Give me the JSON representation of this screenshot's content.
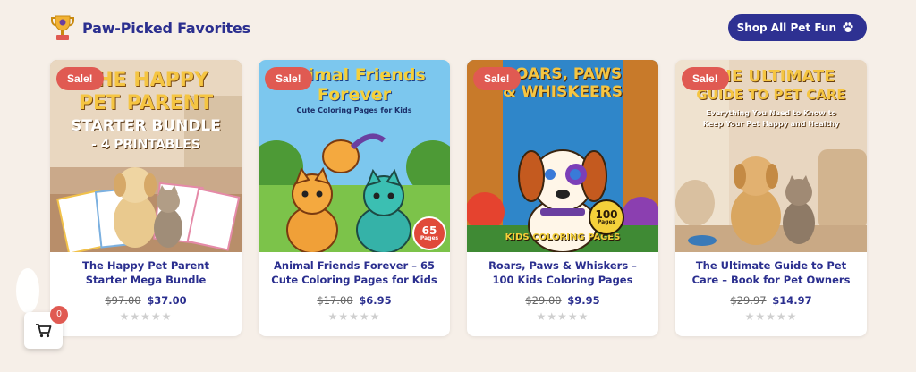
{
  "section": {
    "title": "Paw-Picked Favorites",
    "icon": "trophy-icon"
  },
  "shop_button": {
    "label": "Shop All Pet Fun",
    "icon": "paw-icon"
  },
  "products": [
    {
      "sale_label": "Sale!",
      "cover_lines": [
        "THE HAPPY",
        "PET PARENT",
        "STARTER BUNDLE",
        "- 4 PRINTABLES"
      ],
      "name": "The Happy Pet Parent Starter Mega Bundle",
      "old_price": "$97.00",
      "new_price": "$37.00",
      "rating": 0
    },
    {
      "sale_label": "Sale!",
      "cover_lines": [
        "Animal Friends",
        "Forever",
        "Cute Coloring Pages for Kids"
      ],
      "cover_badge": {
        "number": "65",
        "unit": "Pages"
      },
      "name": "Animal Friends Forever – 65 Cute Coloring Pages for Kids",
      "old_price": "$17.00",
      "new_price": "$6.95",
      "rating": 0
    },
    {
      "sale_label": "Sale!",
      "cover_lines": [
        "ROARS, PAWS",
        "& WHISKEERS",
        "KIDS COLORING PAGES"
      ],
      "cover_badge": {
        "number": "100",
        "unit": "Pages"
      },
      "name": "Roars, Paws & Whiskers – 100 Kids Coloring Pages",
      "old_price": "$29.00",
      "new_price": "$9.95",
      "rating": 0
    },
    {
      "sale_label": "Sale!",
      "cover_lines": [
        "THE ULTIMATE",
        "GUIDE TO PET CARE",
        "Everything You Need to Know to",
        "Keep Your Pet Happy and Healthy"
      ],
      "name": "The Ultimate Guide to Pet Care – Book for Pet Owners",
      "old_price": "$29.97",
      "new_price": "$14.97",
      "rating": 0
    }
  ],
  "cart": {
    "count": "0",
    "icon": "cart-icon"
  },
  "colors": {
    "accent": "#2e3192",
    "sale": "#e05a52",
    "background": "#f6efe8"
  }
}
